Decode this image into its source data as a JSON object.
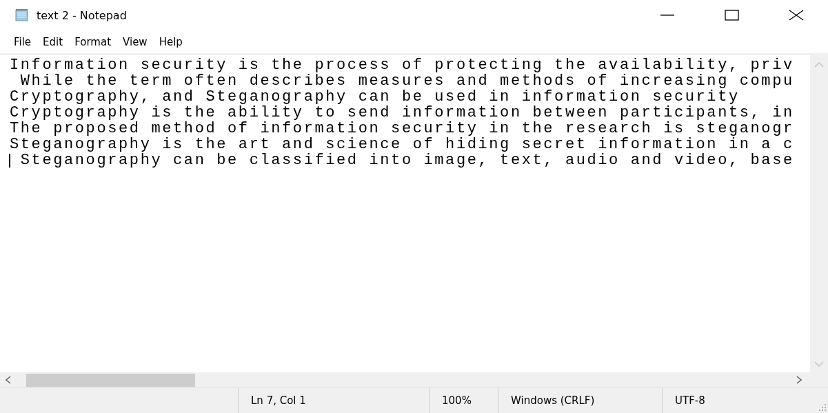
{
  "window": {
    "title": "text 2 - Notepad"
  },
  "menu": [
    "File",
    "Edit",
    "Format",
    "View",
    "Help"
  ],
  "editor": {
    "lines": [
      {
        "text": "Information security is the process of protecting the availability, priv",
        "caret": false
      },
      {
        "text": " While the term often describes measures and methods of increasing compu",
        "caret": false
      },
      {
        "text": "Cryptography, and Steganography can be used in information security",
        "caret": false
      },
      {
        "text": "Cryptography is the ability to send information between participants, in",
        "caret": false
      },
      {
        "text": "The proposed method of information security in the research is steganogr",
        "caret": false
      },
      {
        "text": "Steganography is the art and science of hiding secret information in a c",
        "caret": false
      },
      {
        "text": " Steganography can be classified into image, text, audio and video, base",
        "caret": true
      }
    ]
  },
  "status_bar": [
    "Ln 7, Col 1",
    "100%",
    "Windows (CRLF)",
    "UTF-8"
  ]
}
